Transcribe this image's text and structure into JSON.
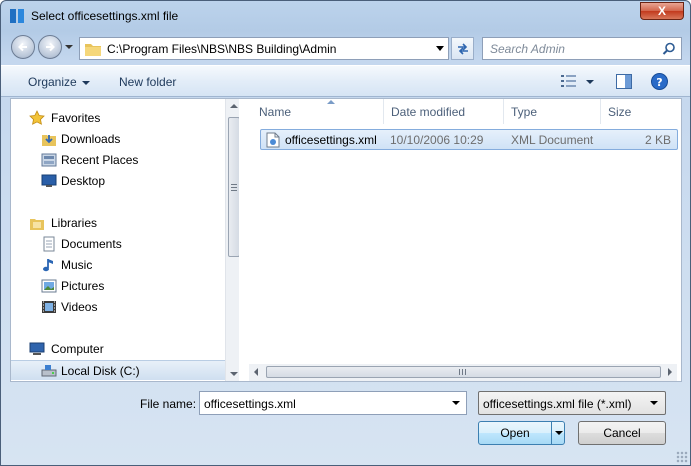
{
  "window": {
    "title": "Select officesettings.xml file",
    "close_label": "X"
  },
  "address_bar": {
    "path": "C:\\Program Files\\NBS\\NBS Building\\Admin",
    "search_placeholder": "Search Admin"
  },
  "toolbar": {
    "organize_label": "Organize",
    "new_folder_label": "New folder"
  },
  "nav_pane": {
    "favorites": {
      "label": "Favorites",
      "items": [
        {
          "label": "Downloads",
          "icon": "downloads-icon"
        },
        {
          "label": "Recent Places",
          "icon": "recent-places-icon"
        },
        {
          "label": "Desktop",
          "icon": "desktop-icon"
        }
      ]
    },
    "libraries": {
      "label": "Libraries",
      "items": [
        {
          "label": "Documents",
          "icon": "documents-icon"
        },
        {
          "label": "Music",
          "icon": "music-icon"
        },
        {
          "label": "Pictures",
          "icon": "pictures-icon"
        },
        {
          "label": "Videos",
          "icon": "videos-icon"
        }
      ]
    },
    "computer": {
      "label": "Computer",
      "items": [
        {
          "label": "Local Disk (C:)",
          "icon": "local-disk-icon"
        }
      ]
    }
  },
  "file_list": {
    "columns": [
      "Name",
      "Date modified",
      "Type",
      "Size"
    ],
    "rows": [
      {
        "name": "officesettings.xml",
        "date": "10/10/2006 10:29",
        "type": "XML Document",
        "size": "2 KB"
      }
    ]
  },
  "footer": {
    "file_name_label": "File name:",
    "file_name_value": "officesettings.xml",
    "filter_value": "officesettings.xml file (*.xml)",
    "open_label": "Open",
    "cancel_label": "Cancel"
  },
  "colors": {
    "accent": "#3399ff",
    "selection": "#cfe2f6",
    "close_button": "#c2391d"
  }
}
